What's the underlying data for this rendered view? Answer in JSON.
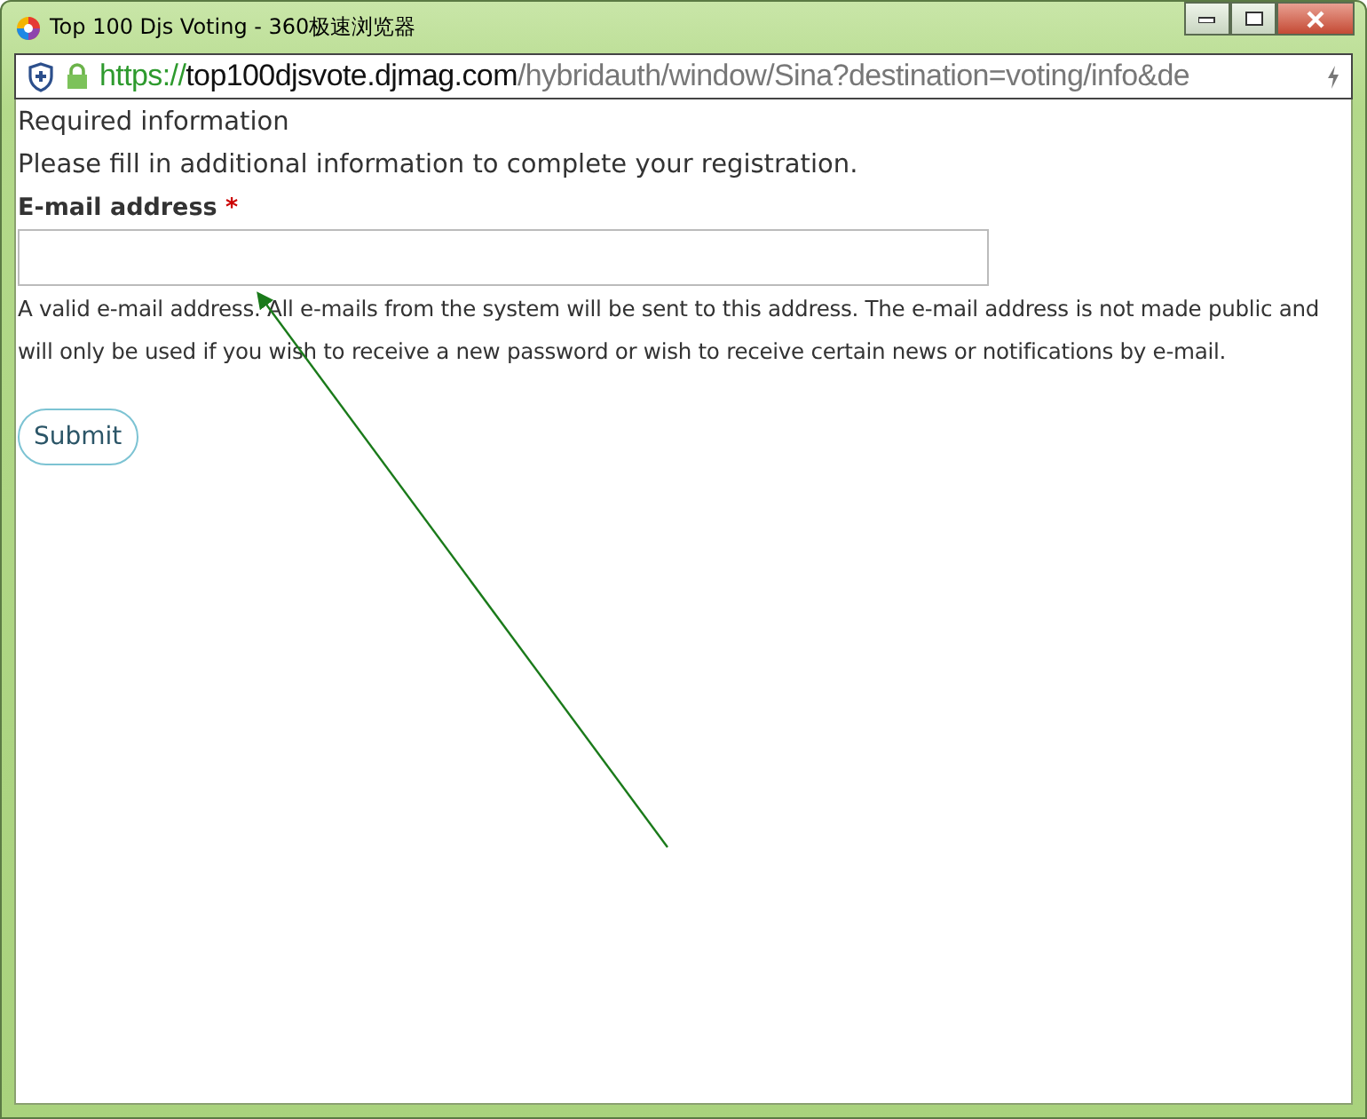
{
  "window": {
    "title": "Top 100 Djs Voting - 360极速浏览器"
  },
  "address_bar": {
    "scheme": "https://",
    "host": "top100djsvote.djmag.com",
    "path": "/hybridauth/window/Sina?destination=voting/info&de"
  },
  "page": {
    "heading": "Required information",
    "intro": "Please fill in additional information to complete your registration.",
    "field": {
      "label": "E-mail address",
      "required_mark": "*",
      "description": "A valid e-mail address. All e-mails from the system will be sent to this address. The e-mail address is not made public and will only be used if you wish to receive a new password or wish to receive certain news or notifications by e-mail."
    },
    "submit": "Submit"
  }
}
